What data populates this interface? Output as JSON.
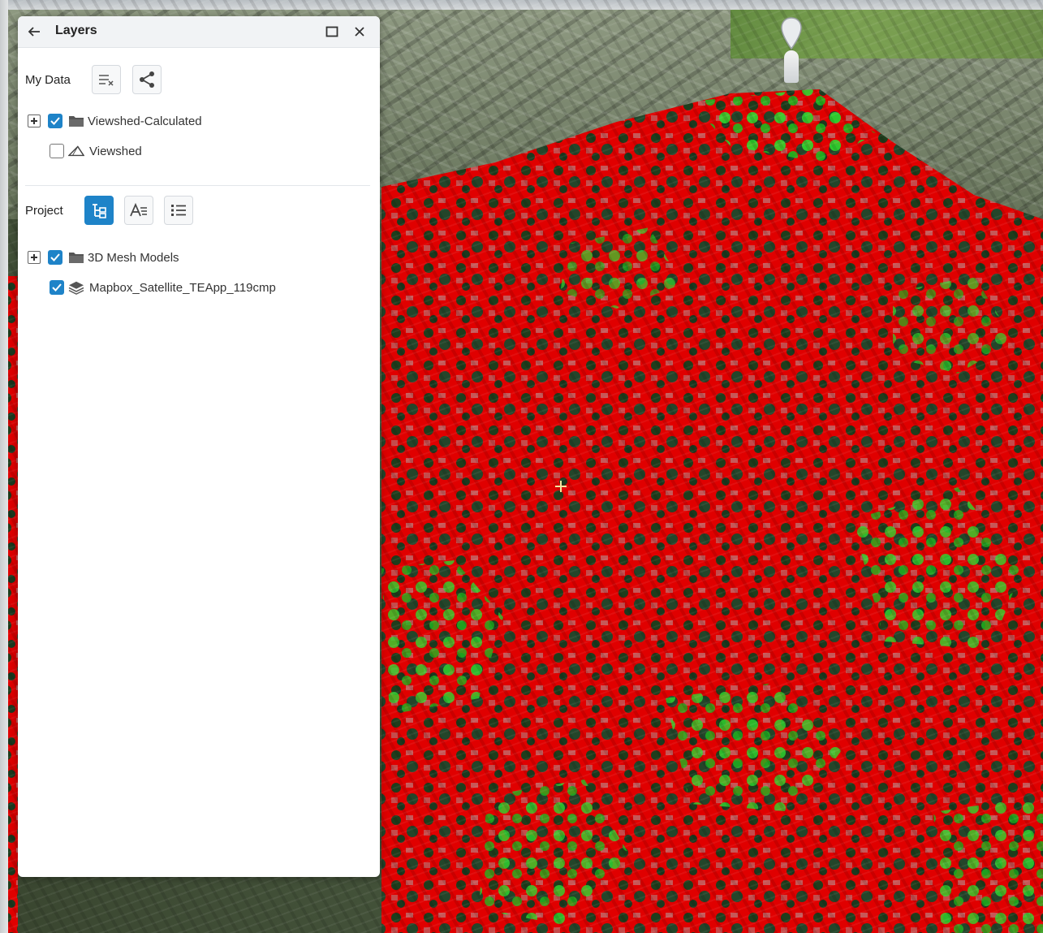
{
  "panel": {
    "title": "Layers",
    "back_icon": "arrow-left-icon",
    "maximize_icon": "maximize-icon",
    "close_icon": "close-icon"
  },
  "my_data": {
    "label": "My Data",
    "tools": [
      {
        "name": "clear-list-icon",
        "active": false
      },
      {
        "name": "share-icon",
        "active": false
      }
    ],
    "items": [
      {
        "label": "Viewshed-Calculated",
        "checked": true,
        "expandable": true,
        "icon": "folder-icon"
      },
      {
        "label": "Viewshed",
        "checked": false,
        "expandable": false,
        "icon": "viewshed-icon"
      }
    ]
  },
  "project": {
    "label": "Project",
    "tools": [
      {
        "name": "tree-view-icon",
        "active": true
      },
      {
        "name": "text-list-icon",
        "active": false
      },
      {
        "name": "bullet-list-icon",
        "active": false
      }
    ],
    "items": [
      {
        "label": "3D Mesh Models",
        "checked": true,
        "expandable": true,
        "icon": "folder-icon"
      },
      {
        "label": "Mapbox_Satellite_TEApp_119cmp",
        "checked": true,
        "expandable": false,
        "icon": "layers-stack-icon"
      }
    ]
  },
  "colors": {
    "accent": "#1e83c8",
    "viewshed_hidden": "#ff0000",
    "viewshed_visible": "#22e622"
  }
}
